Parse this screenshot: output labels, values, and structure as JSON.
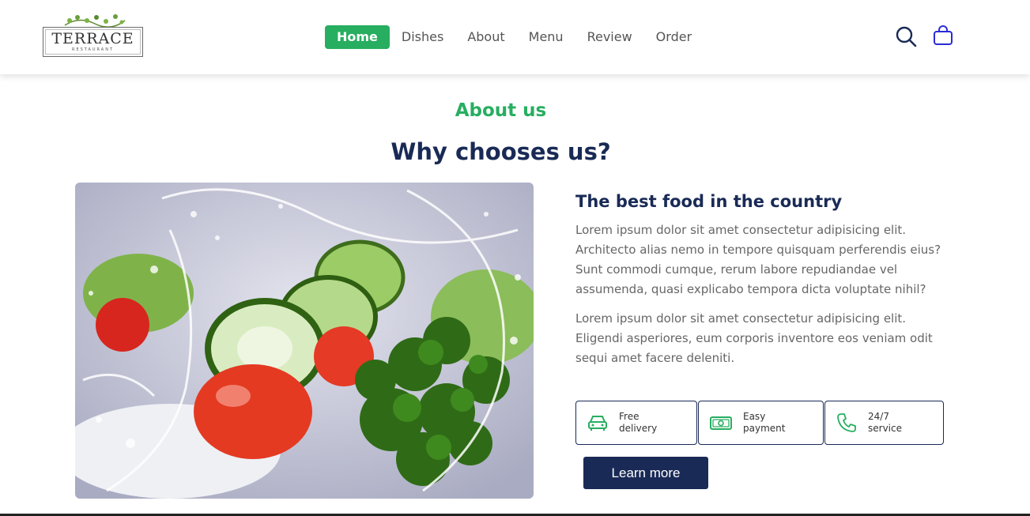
{
  "logo": {
    "word": "TERRACE",
    "sub": "RESTAURANT"
  },
  "nav": {
    "items": [
      {
        "label": "Home",
        "active": true
      },
      {
        "label": "Dishes",
        "active": false
      },
      {
        "label": "About",
        "active": false
      },
      {
        "label": "Menu",
        "active": false
      },
      {
        "label": "Review",
        "active": false
      },
      {
        "label": "Order",
        "active": false
      }
    ],
    "icons": [
      "search-icon",
      "shopping-bag-icon"
    ]
  },
  "section": {
    "eyebrow": "About us",
    "heading": "Why chooses us?"
  },
  "about": {
    "title": "The best food in the country",
    "paragraph_1": "Lorem ipsum dolor sit amet consectetur adipisicing elit. Architecto alias nemo in tempore quisquam perferendis eius? Sunt commodi cumque, rerum labore repudiandae vel assumenda, quasi explicabo tempora dicta voluptate nihil?",
    "paragraph_2": "Lorem ipsum dolor sit amet consectetur adipisicing elit. Eligendi asperiores, eum corporis inventore eos veniam odit sequi amet facere deleniti.",
    "features": [
      {
        "icon": "car-icon",
        "label": "Free\ndelivery"
      },
      {
        "icon": "money-icon",
        "label": "Easy\npayment"
      },
      {
        "icon": "phone-icon",
        "label": "24/7\nservice"
      }
    ],
    "button_label": "Learn more"
  },
  "colors": {
    "accent_green": "#27ae60",
    "navy": "#192a56",
    "text_gray": "#666666"
  }
}
